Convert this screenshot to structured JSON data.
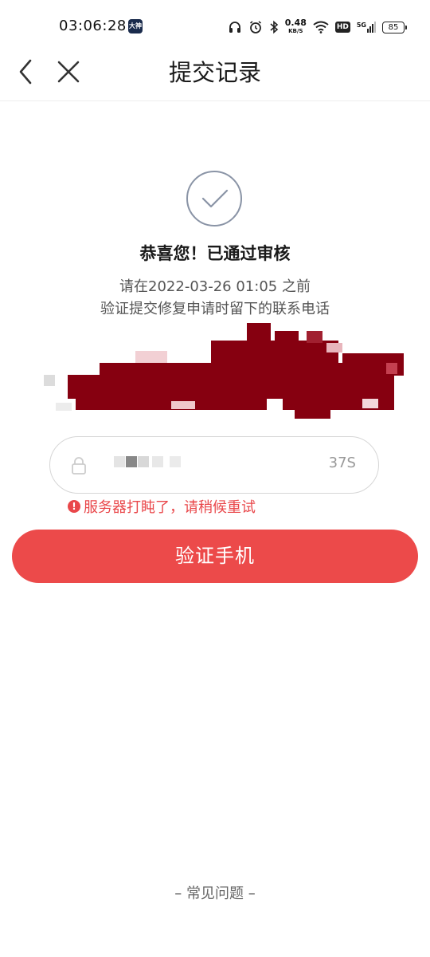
{
  "status_bar": {
    "time": "03:06:28",
    "app_badge": "大神",
    "net_speed_value": "0.48",
    "net_speed_unit": "KB/S",
    "hd_label": "HD",
    "signal_label": "5G",
    "battery": "85"
  },
  "nav": {
    "title": "提交记录"
  },
  "result": {
    "headline": "恭喜您！已通过审核",
    "line1": "请在2022-03-26 01:05 之前",
    "line2": "验证提交修复申请时留下的联系电话"
  },
  "code_field": {
    "value": "",
    "placeholder": "",
    "countdown": "37S"
  },
  "error": {
    "message": "服务器打盹了，请稍候重试"
  },
  "verify_button": {
    "label": "验证手机"
  },
  "faq": {
    "label": "– 常见问题 –"
  },
  "colors": {
    "accent": "#ec4a4a",
    "error": "#e9474a",
    "redacted": "#860010"
  }
}
